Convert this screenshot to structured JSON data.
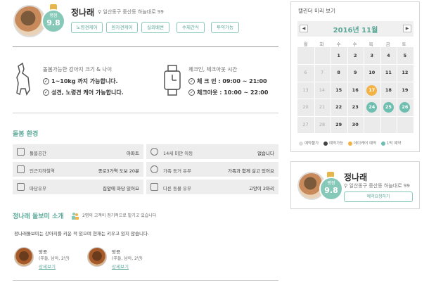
{
  "profile": {
    "name": "정나래",
    "address": "일산동구 중산동 하늘대로 99",
    "rating_caption": "평점",
    "rating": "9.8",
    "tags": [
      "노령견케어",
      "환자견케어",
      "실외배변",
      "수제간식",
      "투약가능"
    ]
  },
  "care_info": {
    "size_title": "돌봄가능한 강아지 크기 & 나이",
    "size_lines": [
      "1~10kg 까지 가능합니다.",
      "성견, 노령견 케어 가능합니다."
    ],
    "time_title": "체크인, 체크아웃 시간",
    "time_lines": [
      "체 크 인 : 09:00 ~ 21:00",
      "체크아웃 : 10:00 ~ 22:00"
    ]
  },
  "environment": {
    "title": "돌봄 환경",
    "rows": [
      {
        "label": "돌봄공간",
        "value": "아파트"
      },
      {
        "label": "14세 미만 아동",
        "value": "없습니다"
      },
      {
        "label": "인근지하철역",
        "value": "종로3가역 도보 20분"
      },
      {
        "label": "가족 동거 유무",
        "value": "가족과 함께 살고 있어요"
      },
      {
        "label": "마당유무",
        "value": "집앞에 마당 있어요"
      },
      {
        "label": "다른 동물 유무",
        "value": "고양이 2마리"
      }
    ]
  },
  "intro": {
    "title": "정나래 돌보미 소개",
    "regulars": "2명의 고객이 정기적으로 맡기고 있습니다",
    "text": "정나래돌보미는 강아지를 키운 적 있으며 현재는 키우고 있지 않습니다.",
    "pets": [
      {
        "name": "망콩",
        "desc": "(푸들, 남아, 2년)",
        "link": "상세보기"
      },
      {
        "name": "망콩",
        "desc": "(푸들, 남아, 2년)",
        "link": "상세보기"
      }
    ]
  },
  "calendar": {
    "panel_title": "캘린더 미리 보기",
    "month": "2016년 11월",
    "prev": "◀",
    "next": "▶",
    "weekdays": [
      "월",
      "화",
      "수",
      "목",
      "금",
      "토"
    ],
    "weeks": [
      [
        "",
        "",
        "1",
        "2",
        "3",
        "4",
        "5"
      ],
      [
        "6",
        "7",
        "8",
        "9",
        "10",
        "11",
        "12"
      ],
      [
        "13",
        "14",
        "15",
        "16",
        "17",
        "18",
        "19"
      ],
      [
        "20",
        "21",
        "22",
        "23",
        "24",
        "25",
        "26"
      ],
      [
        "27",
        "28",
        "29",
        "30",
        "",
        "",
        ""
      ]
    ],
    "legend": [
      "예약불가",
      "예약가능",
      "데이케어 예약",
      "1박 예약"
    ],
    "colors": {
      "orange": "#f3b245",
      "teal": "#6fbfb0",
      "dark": "#444444",
      "gray": "#dddddd"
    }
  },
  "summary_card": {
    "name": "정나래",
    "address": "일산동구 중산동 하늘대로 99",
    "rating_caption": "평점",
    "rating": "9.8",
    "button": "예약요청하기"
  }
}
